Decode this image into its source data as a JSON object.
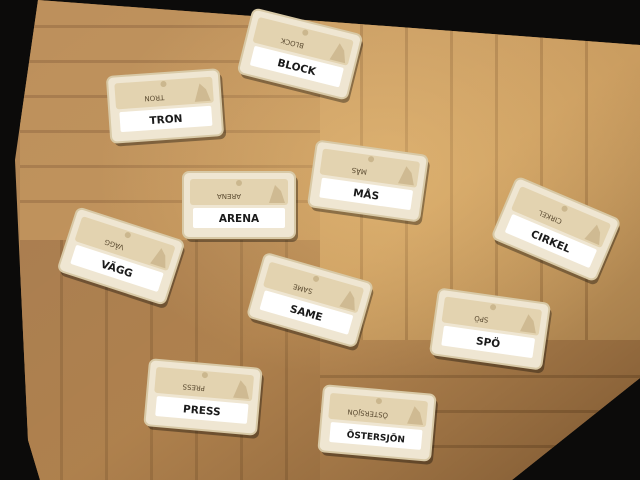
{
  "photo": {
    "background_color": "#0c0b0a",
    "floor_colors": [
      "#b98a4f",
      "#a87742",
      "#c99b5c",
      "#8f6435"
    ],
    "card_color": "#efe6d2",
    "card_border_color": "#d8c9a6",
    "word_box_color": "#ffffff",
    "text_color": "#1a1a1a"
  },
  "cards": [
    {
      "word": "BLOCK",
      "mirrored_word": "BLOCK"
    },
    {
      "word": "TRON",
      "mirrored_word": "TRON"
    },
    {
      "word": "MÅS",
      "mirrored_word": "MÅS"
    },
    {
      "word": "ARENA",
      "mirrored_word": "ARENA"
    },
    {
      "word": "CIRKEL",
      "mirrored_word": "CIRKEL"
    },
    {
      "word": "VÄGG",
      "mirrored_word": "VÄGG"
    },
    {
      "word": "SAME",
      "mirrored_word": "SAME"
    },
    {
      "word": "SPÖ",
      "mirrored_word": "SPÖ"
    },
    {
      "word": "PRESS",
      "mirrored_word": "PRESS"
    },
    {
      "word": "ÖSTERSJÖN",
      "mirrored_word": "ÖSTERSJÖN"
    }
  ]
}
